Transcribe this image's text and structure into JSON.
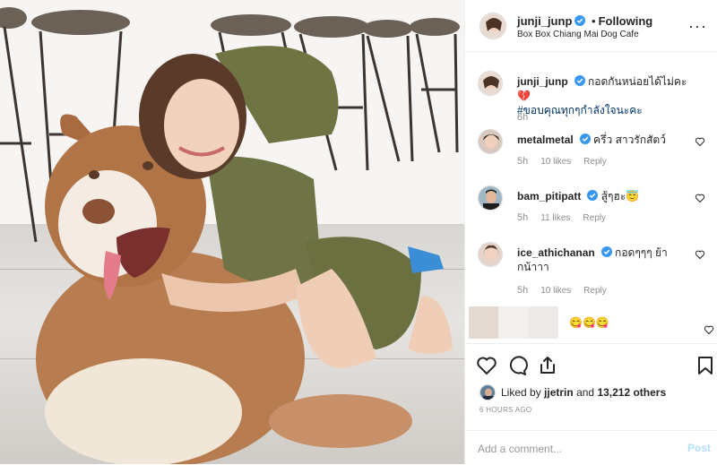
{
  "header": {
    "username": "junji_junp",
    "separator": "•",
    "follow_status": "Following",
    "location": "Box Box Chiang Mai Dog Cafe",
    "more_icon": "more-horizontal-icon"
  },
  "caption": {
    "username": "junji_junp",
    "text": "กอดกันหน่อยได้ไม่คะ 💔",
    "hashtag": "#ขอบคุณทุกๆกำลังใจนะคะ",
    "time": "6h"
  },
  "comments": [
    {
      "username": "metalmetal",
      "text": "ครึ่ว สาวรักสัตว์",
      "time": "5h",
      "likes": "10 likes",
      "reply": "Reply"
    },
    {
      "username": "bam_pitipatt",
      "text": "สู้ๆฮะ😇",
      "time": "5h",
      "likes": "11 likes",
      "reply": "Reply"
    },
    {
      "username": "ice_athichanan",
      "text": "กอดๆๆๆ ย้ากน้าาา",
      "time": "5h",
      "likes": "10 likes",
      "reply": "Reply"
    },
    {
      "username": "",
      "text": "😋😋😋",
      "time": "",
      "likes": "",
      "reply": ""
    }
  ],
  "likes": {
    "prefix": "Liked by",
    "user": "jjetrin",
    "conj": "and",
    "count": "13,212 others"
  },
  "timestamp": "6 HOURS AGO",
  "add_comment": {
    "placeholder": "Add a comment...",
    "post_label": "Post"
  },
  "colors": {
    "verified": "#3897f0",
    "muted": "#8e8e8e",
    "post_disabled": "#b2dffc"
  }
}
